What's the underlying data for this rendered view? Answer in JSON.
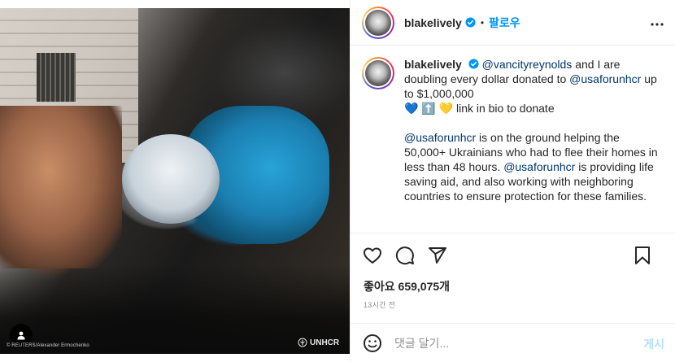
{
  "post": {
    "photo_credit": "© REUTERS/Alexander Ermochenko",
    "watermark": "UNHCR"
  },
  "header": {
    "username": "blakelively",
    "separator": "•",
    "follow_label": "팔로우",
    "more_label": "•••"
  },
  "caption": {
    "username": "blakelively",
    "line1_mention": "@vancityreynolds",
    "line1_text": " and I are doubling every dollar donated to ",
    "line1_mention2": "@usaforunhcr",
    "line1_text2": " up to $1,000,000",
    "line2_emojis": "💙 ⬆️ 💛",
    "line2_text": " link in bio to donate",
    "para2_mention": "@usaforunhcr",
    "para2_text": " is on the ground helping the 50,000+ Ukrainians who had to flee their homes in less than 48 hours. ",
    "para2_mention2": "@usaforunhcr",
    "para2_text2": " is providing life saving aid, and also working with neighboring countries to ensure protection for these families."
  },
  "stats": {
    "likes_label": "좋아요 659,075개",
    "time_ago": "13시간 전"
  },
  "comment": {
    "placeholder": "댓글 달기...",
    "post_label": "게시"
  },
  "colors": {
    "accent": "#0095f6",
    "mention": "#00376b",
    "post_disabled": "#b2dffc",
    "text": "#262626",
    "muted": "#8e8e8e"
  }
}
